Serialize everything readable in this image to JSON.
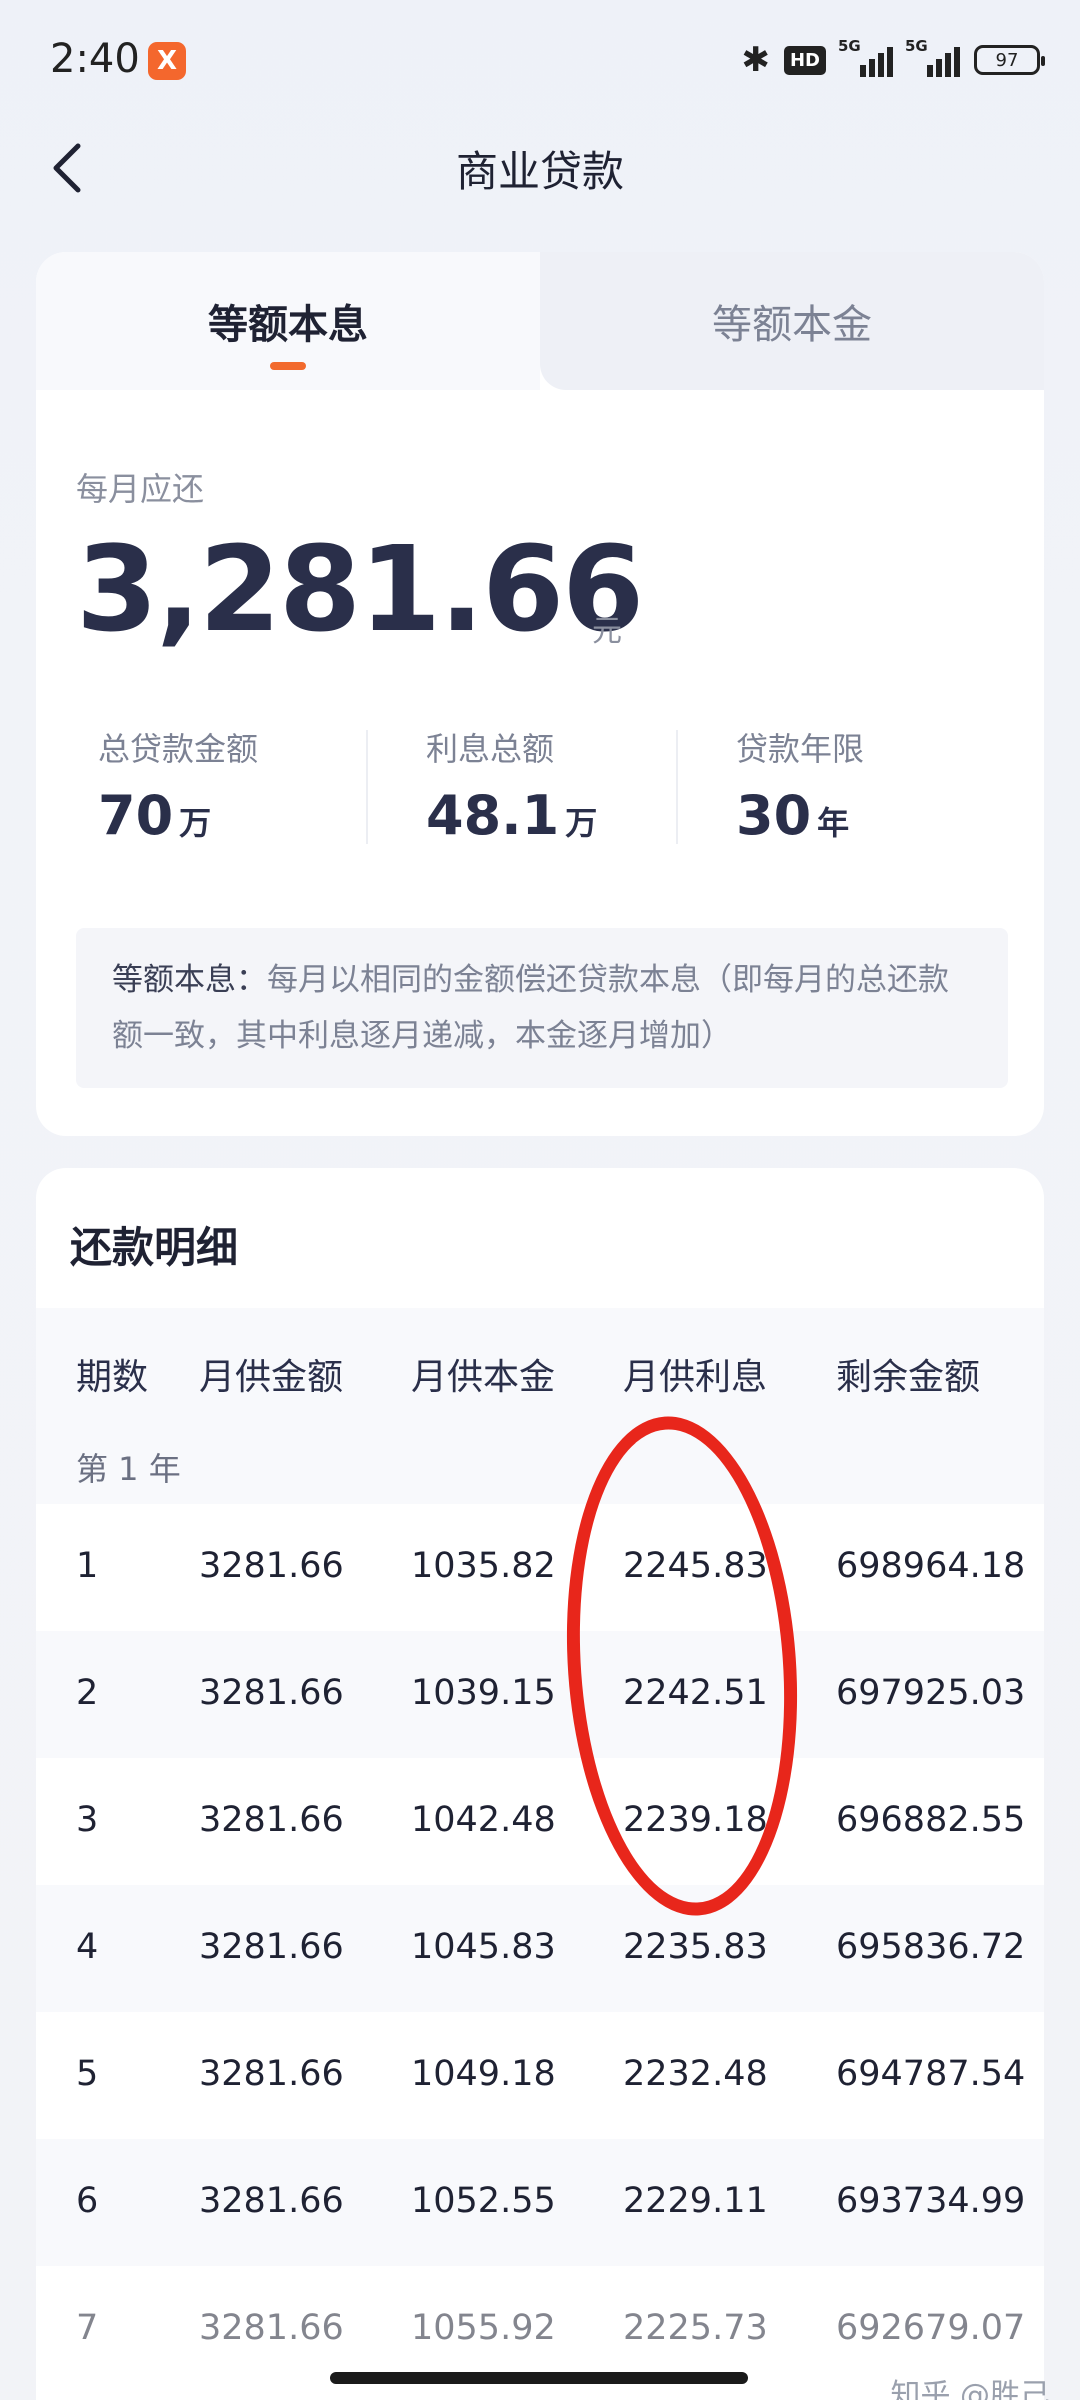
{
  "status_bar": {
    "time": "2:40",
    "app_badge": "X",
    "hd": "HD",
    "sig1": "5G",
    "sig2": "5G",
    "battery": "97"
  },
  "header": {
    "title": "商业贷款"
  },
  "tabs": [
    {
      "label": "等额本息",
      "active": true
    },
    {
      "label": "等额本金",
      "active": false
    }
  ],
  "summary": {
    "monthly_label": "每月应还",
    "monthly_value": "3,281.66",
    "monthly_unit": "元",
    "stats": [
      {
        "label": "总贷款金额",
        "value": "70",
        "unit": "万"
      },
      {
        "label": "利息总额",
        "value": "48.1",
        "unit": "万"
      },
      {
        "label": "贷款年限",
        "value": "30",
        "unit": "年"
      }
    ],
    "desc_key": "等额本息：",
    "desc_text": "每月以相同的金额偿还贷款本息（即每月的总还款额一致，其中利息逐月递减，本金逐月增加）"
  },
  "detail": {
    "title": "还款明细",
    "columns": [
      "期数",
      "月供金额",
      "月供本金",
      "月供利息",
      "剩余金额"
    ],
    "year_label": "第 1 年",
    "rows": [
      [
        "1",
        "3281.66",
        "1035.82",
        "2245.83",
        "698964.18"
      ],
      [
        "2",
        "3281.66",
        "1039.15",
        "2242.51",
        "697925.03"
      ],
      [
        "3",
        "3281.66",
        "1042.48",
        "2239.18",
        "696882.55"
      ],
      [
        "4",
        "3281.66",
        "1045.83",
        "2235.83",
        "695836.72"
      ],
      [
        "5",
        "3281.66",
        "1049.18",
        "2232.48",
        "694787.54"
      ],
      [
        "6",
        "3281.66",
        "1052.55",
        "2229.11",
        "693734.99"
      ],
      [
        "7",
        "3281.66",
        "1055.92",
        "2225.73",
        "692679.07"
      ]
    ]
  },
  "watermark": "知乎 @胜己",
  "colors": {
    "accent": "#f26a2d",
    "annotation": "#e8261b",
    "value_text": "#2a2f4a"
  }
}
